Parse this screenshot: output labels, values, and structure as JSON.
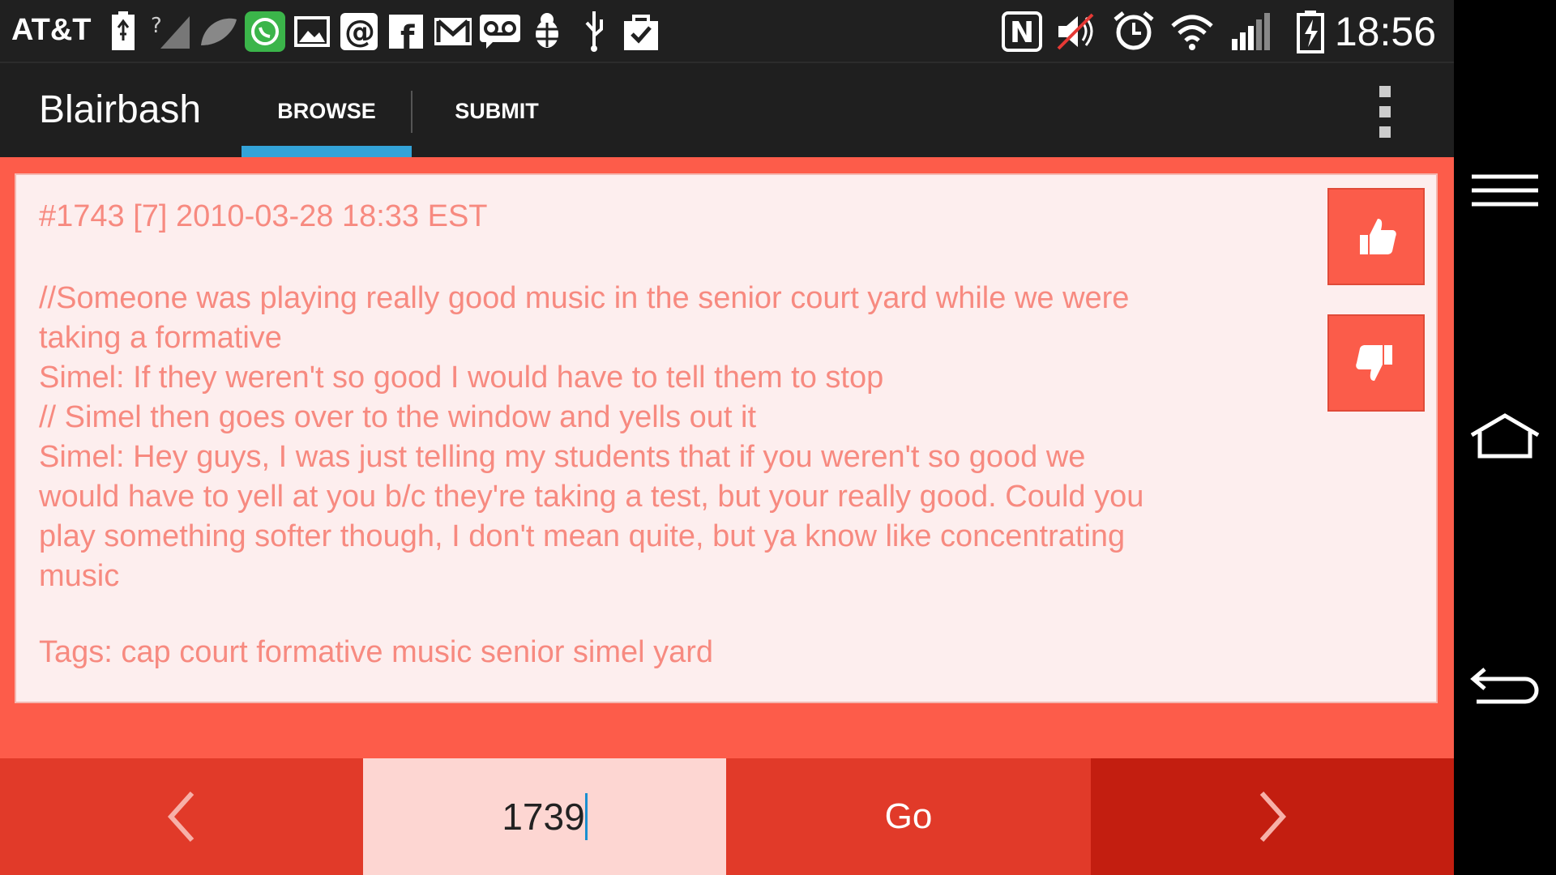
{
  "status_bar": {
    "carrier": "AT&T",
    "time": "18:56",
    "icons": [
      "usb-battery-icon",
      "no-signal-icon",
      "leaf-icon",
      "whatsapp-icon",
      "gallery-icon",
      "email-at-icon",
      "facebook-icon",
      "gmail-icon",
      "voicemail-icon",
      "bug-icon",
      "usb-icon",
      "shopping-bag-icon",
      "nfc-icon",
      "mute-icon",
      "alarm-icon",
      "wifi-icon",
      "signal-icon",
      "battery-charging-icon"
    ]
  },
  "action_bar": {
    "title": "Blairbash",
    "tabs": [
      {
        "label": "BROWSE",
        "selected": true
      },
      {
        "label": "SUBMIT",
        "selected": false
      }
    ],
    "accent_color": "#33a3d8"
  },
  "quote": {
    "meta": "#1743 [7] 2010-03-28 18:33 EST",
    "lines": [
      "//Someone was playing really good music in the senior court yard while we were",
      "taking a formative",
      "Simel: If they weren't so good I would have to tell them to stop",
      "// Simel then goes over to the window and yells out it",
      "Simel: Hey guys, I was just telling my students that if you weren't so good we",
      "would have to yell at you b/c they're taking a test, but your really good. Could you",
      "play something softer though, I don't mean quite, but ya know like concentrating",
      "music"
    ],
    "tags": "Tags: cap court formative music senior simel yard"
  },
  "bottom_bar": {
    "prev_icon": "chevron-left-icon",
    "page_value": "1739",
    "go_label": "Go",
    "next_icon": "chevron-right-icon"
  },
  "colors": {
    "background": "#fd5c4a",
    "card": "#fdeeee",
    "text": "#f78a80",
    "button": "#fb5c4a"
  }
}
